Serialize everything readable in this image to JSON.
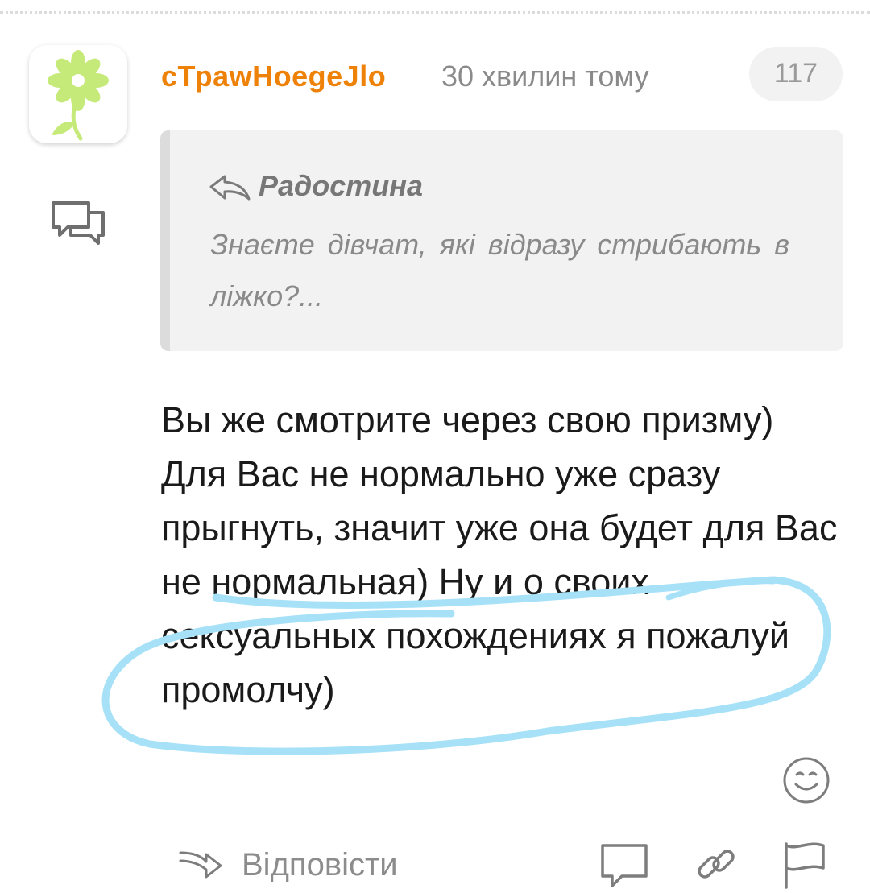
{
  "comment": {
    "author": "сТрawHoegeJlo",
    "time": "30 хвилин тому",
    "likes": "117",
    "text": "Вы же смотрите через свою призму) Для Вас не нормально уже сразу прыгнуть, значит уже она будет для Вас не нормальная) Ну и о своих сексуальных похождениях я пожалуй промолчу)"
  },
  "quote": {
    "author": "Радостина",
    "text": "Знаєте дівчат, які відразу стрибають в ліжко?..."
  },
  "actions": {
    "reply_label": "Відповісти"
  },
  "icons": {
    "avatar": "flower-avatar-icon",
    "chat": "chat-bubbles-icon",
    "reply_arrow": "reply-arrow-icon",
    "smiley": "smiley-icon",
    "reply": "reply-icon",
    "comment": "comment-icon",
    "link": "link-icon",
    "flag": "flag-icon"
  },
  "colors": {
    "author": "#ee8208",
    "avatar_flower": "#c6ea7a",
    "annotation": "#a6e1f7",
    "muted": "#8a8a8a"
  }
}
